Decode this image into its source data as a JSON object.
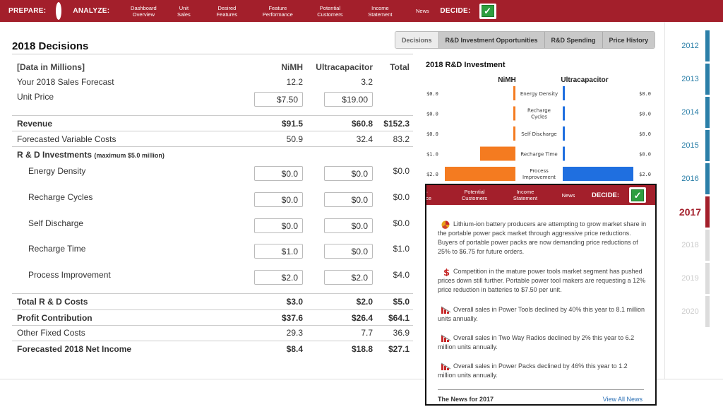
{
  "nav": {
    "prepare": "PREPARE:",
    "analyze": "ANALYZE:",
    "items": [
      {
        "line1": "Dashboard",
        "line2": "Overview"
      },
      {
        "line1": "Unit",
        "line2": "Sales"
      },
      {
        "line1": "Desired",
        "line2": "Features"
      },
      {
        "line1": "Feature",
        "line2": "Performance"
      },
      {
        "line1": "Potential",
        "line2": "Customers"
      },
      {
        "line1": "Income",
        "line2": "Statement"
      },
      {
        "line1": "News",
        "line2": ""
      }
    ],
    "decide": "DECIDE:"
  },
  "page": {
    "title": "2018 Decisions"
  },
  "table": {
    "headers": {
      "label": "[Data in Millions]",
      "nimh": "NiMH",
      "ultra": "Ultracapacitor",
      "total": "Total"
    },
    "sales_forecast": {
      "label": "Your 2018 Sales Forecast",
      "nimh": "12.2",
      "ultra": "3.2"
    },
    "unit_price": {
      "label": "Unit Price",
      "nimh": "$7.50",
      "ultra": "$19.00"
    },
    "revenue": {
      "label": "Revenue",
      "nimh": "$91.5",
      "ultra": "$60.8",
      "total": "$152.3"
    },
    "variable_costs": {
      "label": "Forecasted Variable Costs",
      "nimh": "50.9",
      "ultra": "32.4",
      "total": "83.2"
    },
    "rd_header": {
      "label": "R & D Investments",
      "note": "(maximum $5.0 million)"
    },
    "rd_rows": [
      {
        "label": "Energy Density",
        "nimh": "$0.0",
        "ultra": "$0.0",
        "total": "$0.0"
      },
      {
        "label": "Recharge Cycles",
        "nimh": "$0.0",
        "ultra": "$0.0",
        "total": "$0.0"
      },
      {
        "label": "Self Discharge",
        "nimh": "$0.0",
        "ultra": "$0.0",
        "total": "$0.0"
      },
      {
        "label": "Recharge Time",
        "nimh": "$1.0",
        "ultra": "$0.0",
        "total": "$1.0"
      },
      {
        "label": "Process Improvement",
        "nimh": "$2.0",
        "ultra": "$2.0",
        "total": "$4.0"
      }
    ],
    "total_rd": {
      "label": "Total R & D Costs",
      "nimh": "$3.0",
      "ultra": "$2.0",
      "total": "$5.0"
    },
    "profit": {
      "label": "Profit Contribution",
      "nimh": "$37.6",
      "ultra": "$26.4",
      "total": "$64.1"
    },
    "fixed": {
      "label": "Other Fixed Costs",
      "nimh": "29.3",
      "ultra": "7.7",
      "total": "36.9"
    },
    "net_income": {
      "label": "Forecasted 2018 Net Income",
      "nimh": "$8.4",
      "ultra": "$18.8",
      "total": "$27.1"
    }
  },
  "tabs": [
    "Decisions",
    "R&D Investment Opportunities",
    "R&D Spending",
    "Price History"
  ],
  "chart_data": {
    "type": "bar",
    "title": "2018 R&D Investment",
    "orientation": "horizontal-butterfly",
    "categories": [
      "Energy Density",
      "Recharge Cycles",
      "Self Discharge",
      "Recharge Time",
      "Process Improvement"
    ],
    "category_lines": [
      [
        "Energy Density"
      ],
      [
        "Recharge",
        "Cycles"
      ],
      [
        "Self Discharge"
      ],
      [
        "Recharge Time"
      ],
      [
        "Process",
        "Improvement"
      ]
    ],
    "series": [
      {
        "name": "NiMH",
        "values": [
          0.0,
          0.0,
          0.0,
          1.0,
          2.0
        ],
        "labels": [
          "$0.0",
          "$0.0",
          "$0.0",
          "$1.0",
          "$2.0"
        ],
        "color": "#f47b20"
      },
      {
        "name": "Ultracapacitor",
        "values": [
          0.0,
          0.0,
          0.0,
          0.0,
          2.0
        ],
        "labels": [
          "$0.0",
          "$0.0",
          "$0.0",
          "$0.0",
          "$2.0"
        ],
        "color": "#1f6fe0"
      }
    ],
    "xlim": [
      0,
      2
    ]
  },
  "years": [
    {
      "label": "2012",
      "state": "past"
    },
    {
      "label": "2013",
      "state": "past"
    },
    {
      "label": "2014",
      "state": "past"
    },
    {
      "label": "2015",
      "state": "past"
    },
    {
      "label": "2016",
      "state": "past"
    },
    {
      "label": "2017",
      "state": "current"
    },
    {
      "label": "2018",
      "state": "future"
    },
    {
      "label": "2019",
      "state": "future"
    },
    {
      "label": "2020",
      "state": "future"
    }
  ],
  "colors": {
    "brand": "#a31f2b",
    "past_year": "#2b7fa8",
    "current_year": "#a31f2b",
    "future_year": "#cccccc"
  },
  "news": {
    "nav": [
      {
        "line1": "·",
        "line2": "nce"
      },
      {
        "line1": "Potential",
        "line2": "Customers"
      },
      {
        "line1": "Income",
        "line2": "Statement"
      },
      {
        "line1": "News",
        "line2": ""
      }
    ],
    "decide": "DECIDE:",
    "items": [
      {
        "icon": "pie-chart-icon",
        "text": "Lithium-ion battery producers are attempting to grow market share in the portable power pack market through aggressive price reductions. Buyers of portable power packs are now demanding price reductions of 25% to $6.75 for future orders."
      },
      {
        "icon": "dollar-icon",
        "text": "Competition in the mature power tools market segment has pushed prices down still further. Portable power tool makers are requesting a 12% price reduction in batteries to $7.50 per unit."
      },
      {
        "icon": "decline-chart-icon",
        "text": "Overall sales in Power Tools declined by 40% this year to 8.1 million units annually."
      },
      {
        "icon": "decline-chart-icon",
        "text": "Overall sales in Two Way Radios declined by 2% this year to 6.2 million units annually."
      },
      {
        "icon": "decline-chart-icon",
        "text": "Overall sales in Power Packs declined by 46% this year to 1.2 million units annually."
      }
    ],
    "footer": "The News for 2017",
    "view_all": "View All News"
  }
}
